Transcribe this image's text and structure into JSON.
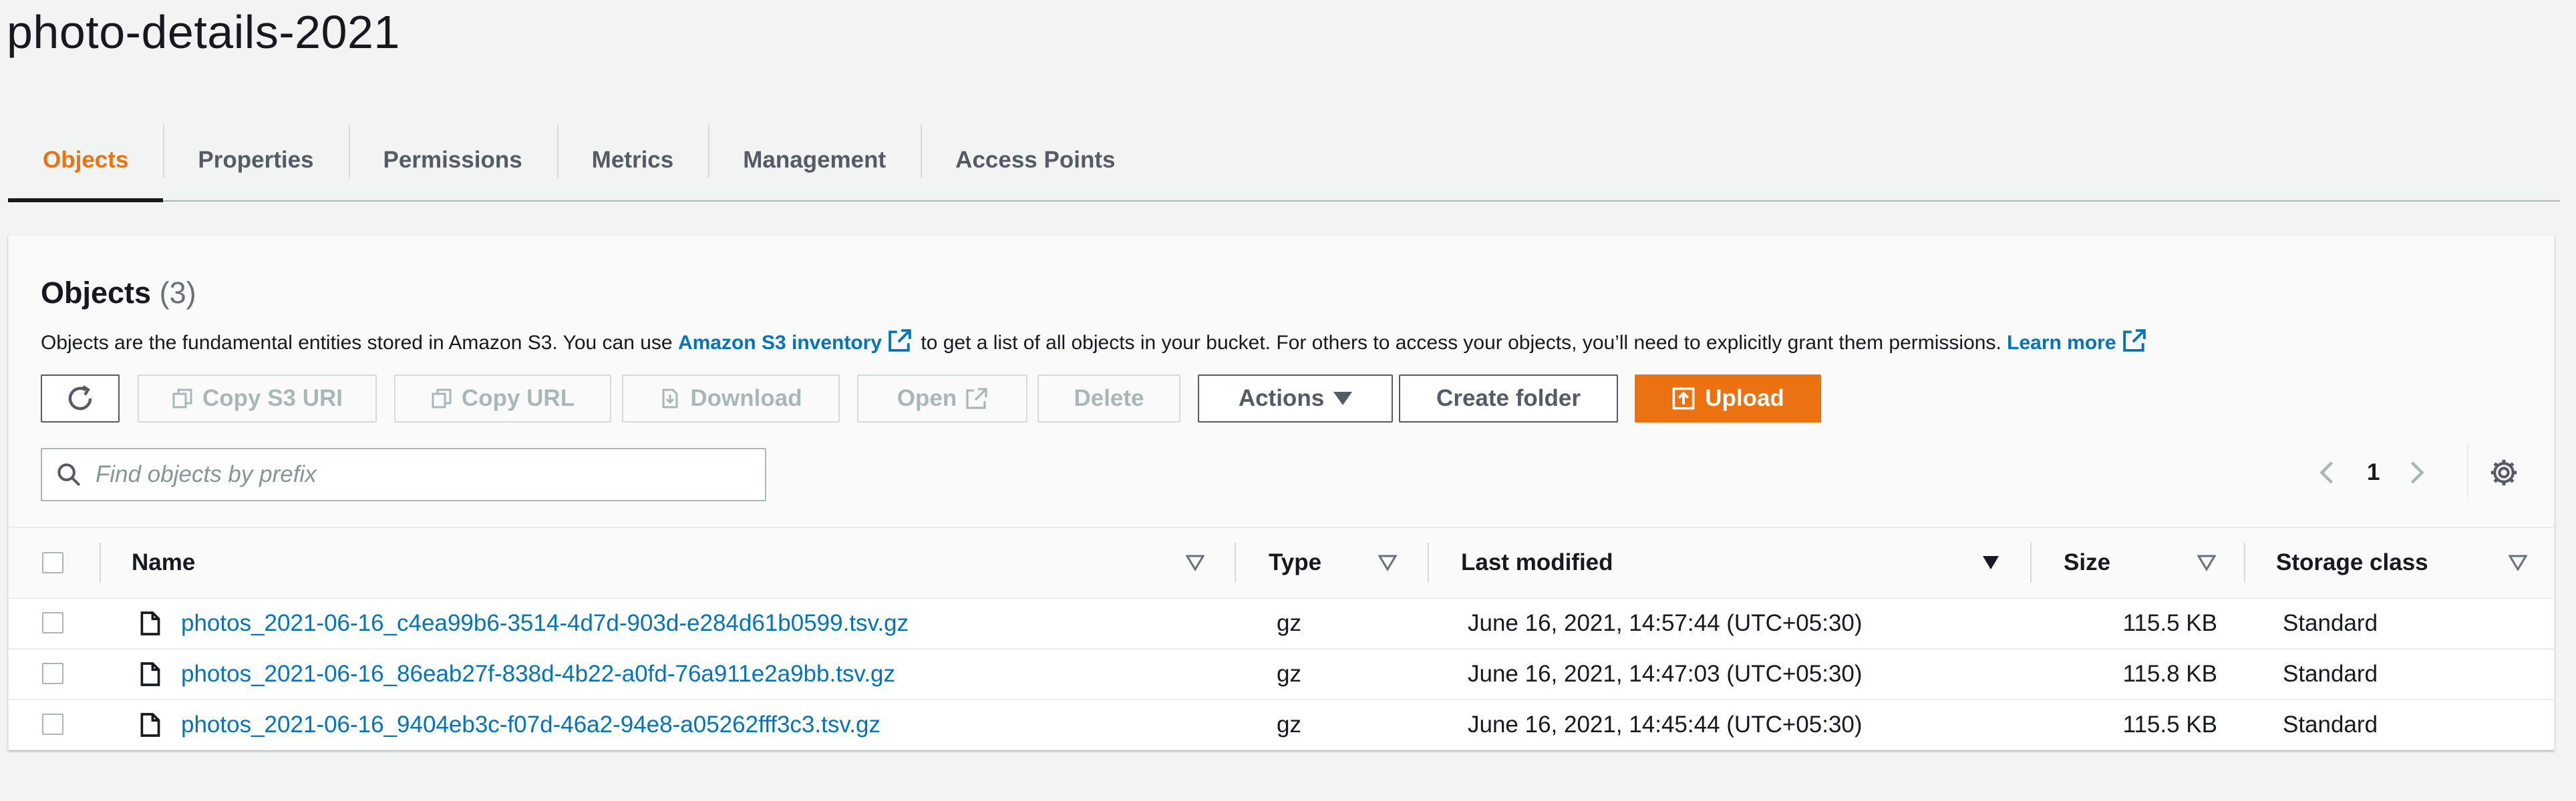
{
  "bucket_title": "photo-details-2021",
  "tabs": [
    {
      "label": "Objects",
      "active": true
    },
    {
      "label": "Properties"
    },
    {
      "label": "Permissions"
    },
    {
      "label": "Metrics"
    },
    {
      "label": "Management"
    },
    {
      "label": "Access Points"
    }
  ],
  "objects_panel": {
    "title": "Objects",
    "count": "(3)",
    "description": {
      "before": "Objects are the fundamental entities stored in Amazon S3. You can use",
      "inventory_link": "Amazon S3 inventory",
      "middle": "to get a list of all objects in your bucket. For others to access your objects, you’ll need to explicitly grant them permissions.",
      "learn_more": "Learn more"
    }
  },
  "toolbar": {
    "copy_s3_uri": "Copy S3 URI",
    "copy_url": "Copy URL",
    "download": "Download",
    "open": "Open",
    "delete": "Delete",
    "actions": "Actions",
    "create_folder": "Create folder",
    "upload": "Upload"
  },
  "search": {
    "placeholder": "Find objects by prefix",
    "value": ""
  },
  "pagination": {
    "current_page": "1"
  },
  "table": {
    "columns": [
      "Name",
      "Type",
      "Last modified",
      "Size",
      "Storage class"
    ],
    "rows": [
      {
        "name": "photos_2021-06-16_c4ea99b6-3514-4d7d-903d-e284d61b0599.tsv.gz",
        "type": "gz",
        "last_modified": "June 16, 2021, 14:57:44 (UTC+05:30)",
        "size": "115.5 KB",
        "storage_class": "Standard"
      },
      {
        "name": "photos_2021-06-16_86eab27f-838d-4b22-a0fd-76a911e2a9bb.tsv.gz",
        "type": "gz",
        "last_modified": "June 16, 2021, 14:47:03 (UTC+05:30)",
        "size": "115.8 KB",
        "storage_class": "Standard"
      },
      {
        "name": "photos_2021-06-16_9404eb3c-f07d-46a2-94e8-a05262fff3c3.tsv.gz",
        "type": "gz",
        "last_modified": "June 16, 2021, 14:45:44 (UTC+05:30)",
        "size": "115.5 KB",
        "storage_class": "Standard"
      }
    ]
  },
  "colors": {
    "accent": "#ec7211",
    "link": "#0073bb",
    "text": "#16191f",
    "disabled": "#aab7b8"
  },
  "icons": [
    "refresh-icon",
    "copy-icon",
    "download-icon",
    "external-link-icon",
    "caret-down-icon",
    "upload-icon",
    "search-icon",
    "chevron-left-icon",
    "chevron-right-icon",
    "gear-icon",
    "file-icon",
    "sort-icon"
  ]
}
